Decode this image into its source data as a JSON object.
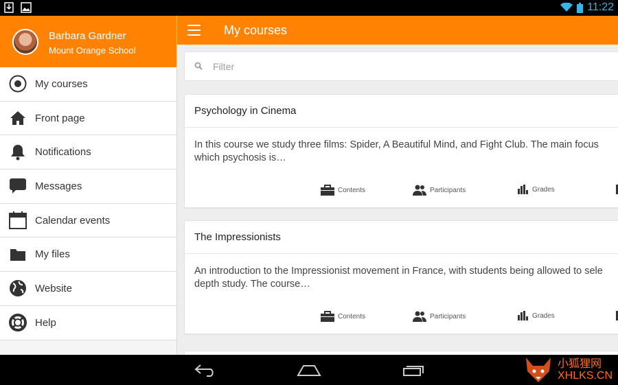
{
  "status_bar": {
    "time": "11:22"
  },
  "drawer": {
    "user_name": "Barbara Gardner",
    "user_school": "Mount Orange School",
    "items": [
      {
        "label": "My courses",
        "icon": "target-circle-icon"
      },
      {
        "label": "Front page",
        "icon": "home-icon"
      },
      {
        "label": "Notifications",
        "icon": "bell-icon"
      },
      {
        "label": "Messages",
        "icon": "chat-bubble-icon"
      },
      {
        "label": "Calendar events",
        "icon": "calendar-icon"
      },
      {
        "label": "My files",
        "icon": "folder-icon"
      },
      {
        "label": "Website",
        "icon": "globe-icon"
      },
      {
        "label": "Help",
        "icon": "lifebuoy-icon"
      }
    ]
  },
  "app_bar": {
    "title": "My courses",
    "menu_icon": "hamburger-menu-icon"
  },
  "filter": {
    "placeholder": "Filter",
    "value": ""
  },
  "courses": [
    {
      "title": "Psychology in Cinema",
      "summary_line1": "In this course we study three films: Spider, A Beautiful Mind, and Fight Club. The main focus",
      "summary_line2": "which psychosis is…"
    },
    {
      "title": "The Impressionists",
      "summary_line1": "An introduction to the Impressionist movement in France, with students being allowed to sele",
      "summary_line2": "depth study. The course…"
    }
  ],
  "course_actions": {
    "contents": "Contents",
    "participants": "Participants",
    "grades": "Grades"
  },
  "watermark": {
    "line1": "小狐狸网",
    "line2": "XHLKS.CN"
  },
  "colors": {
    "accent": "#ff8300",
    "status_time": "#33b5e5"
  }
}
